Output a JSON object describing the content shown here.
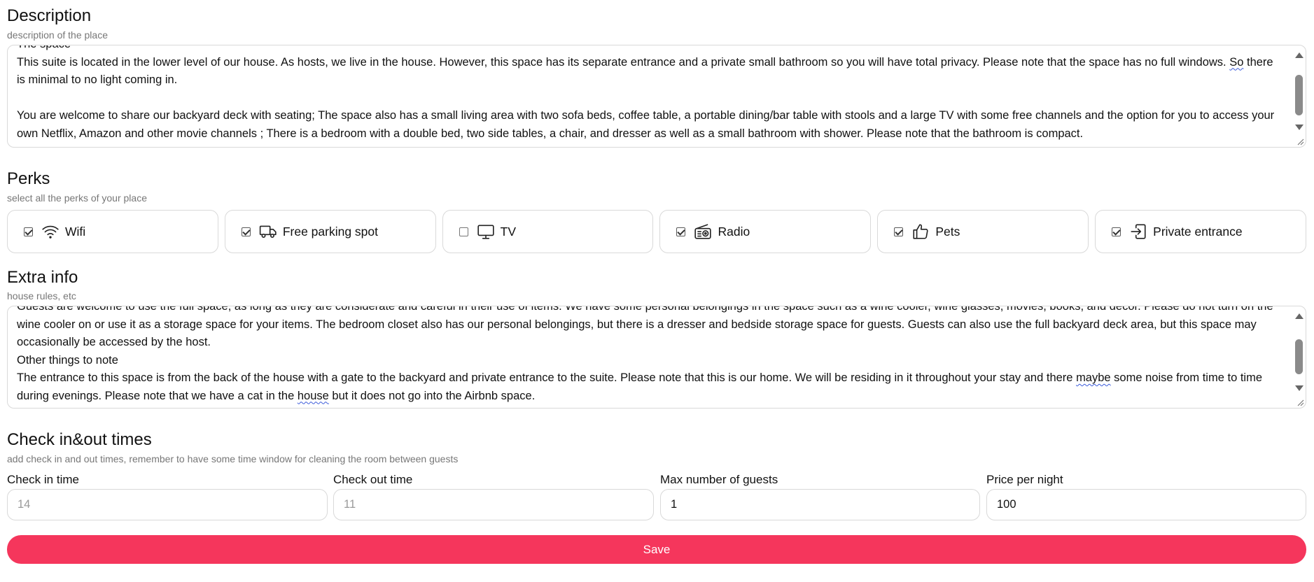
{
  "description": {
    "title": "Description",
    "subtitle": "description of the place",
    "cut_top_line": "The space",
    "para1_a": "This suite is located in the lower level of our house. As hosts, we live in the house. However, this space has its separate entrance and a private small bathroom so you will have total privacy. Please note that the space has no full windows. ",
    "para1_flag": "So",
    "para1_b": " there is minimal to no light coming in.",
    "para2": "You are welcome to share our backyard deck with seating; The space also has a small living area with two sofa beds, coffee table, a portable dining/bar table with stools and a large TV with some free channels and the option for you to access your own Netflix, Amazon and other movie channels ; There is a bedroom with a double bed, two side tables, a chair, and dresser as well as a small bathroom with shower. Please note that the bathroom is compact."
  },
  "perks": {
    "title": "Perks",
    "subtitle": "select all the perks of your place",
    "items": [
      {
        "label": "Wifi",
        "checked": true,
        "icon": "wifi-icon"
      },
      {
        "label": "Free parking spot",
        "checked": true,
        "icon": "truck-icon"
      },
      {
        "label": "TV",
        "checked": false,
        "icon": "tv-icon"
      },
      {
        "label": "Radio",
        "checked": true,
        "icon": "radio-icon"
      },
      {
        "label": "Pets",
        "checked": true,
        "icon": "thumbs-up-icon"
      },
      {
        "label": "Private entrance",
        "checked": true,
        "icon": "enter-door-icon"
      }
    ]
  },
  "extra": {
    "title": "Extra info",
    "subtitle": "house rules, etc",
    "cut_top_line": "Guests are welcome to use the full space, as long as they are considerate and careful in their use of items. We have some personal belongings in the space such as a wine cooler, wine glasses, movies, books, and decor. Please do not turn on the",
    "line2": "wine cooler on or use it as a storage space for your items. The bedroom closet also has our personal belongings, but there is a dresser and bedside storage space for guests. Guests can also use the full backyard deck area, but this space may occasionally be accessed by the host.",
    "line3": "Other things to note",
    "para_a": "The entrance to this space is from the back of the house with a gate to the backyard and private entrance to the suite. Please note that this is our home. We will be residing in it throughout your stay and there ",
    "para_flag1": "maybe",
    "para_b": " some noise from time to time during evenings. Please note that we have a cat in the ",
    "para_flag2": "house",
    "para_c": " but it does not go into the Airbnb space."
  },
  "checkinout": {
    "title": "Check in&out times",
    "subtitle": "add check in and out times, remember to have some time window for cleaning the room between guests",
    "fields": [
      {
        "label": "Check in time",
        "value": "",
        "placeholder": "14"
      },
      {
        "label": "Check out time",
        "value": "",
        "placeholder": "11"
      },
      {
        "label": "Max number of guests",
        "value": "1",
        "placeholder": ""
      },
      {
        "label": "Price per night",
        "value": "100",
        "placeholder": ""
      }
    ]
  },
  "save_label": "Save",
  "colors": {
    "accent": "#f5365c",
    "border": "#d9d9d9",
    "muted": "#777777"
  }
}
